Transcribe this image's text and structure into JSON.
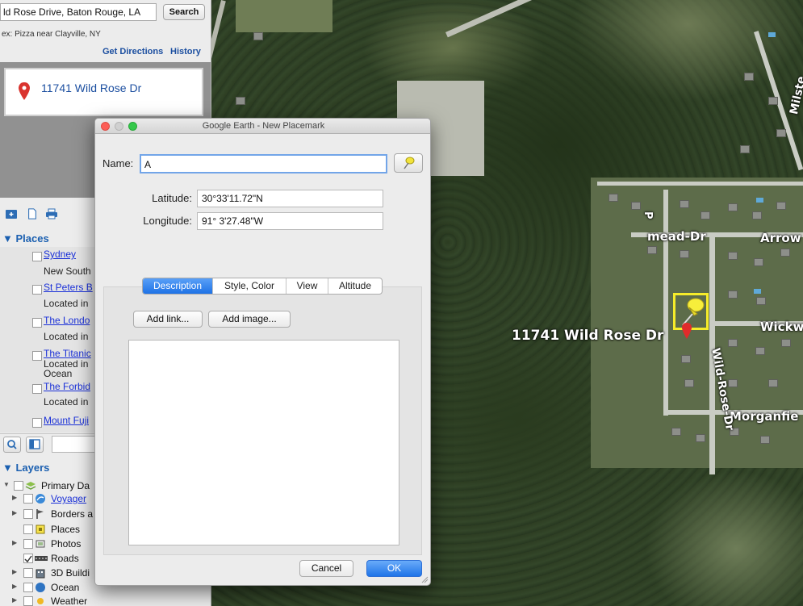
{
  "search": {
    "value": "ld Rose Drive, Baton Rouge, LA",
    "button_label": "Search",
    "hint": "ex: Pizza near Clayville, NY",
    "get_directions": "Get Directions",
    "history": "History"
  },
  "result": {
    "title": "11741 Wild Rose Dr"
  },
  "places": {
    "header": "▼ Places",
    "items": [
      {
        "title": "Sydney",
        "desc": "New South"
      },
      {
        "title": "St Peters B",
        "desc": "Located in"
      },
      {
        "title": "The Londo",
        "desc": "Located in"
      },
      {
        "title": "The Titanic",
        "desc": "Located in",
        "desc2": "Ocean"
      },
      {
        "title": "The Forbid",
        "desc": "Located in"
      },
      {
        "title": "Mount Fuji"
      }
    ]
  },
  "layers": {
    "header": "▼ Layers",
    "items": [
      {
        "label": "Primary Da",
        "link": false,
        "icon": "layers-icon"
      },
      {
        "label": "Voyager",
        "link": true,
        "icon": "voyager-icon"
      },
      {
        "label": "Borders a",
        "link": false,
        "icon": "flag-icon"
      },
      {
        "label": "Places",
        "link": false,
        "icon": "places-icon"
      },
      {
        "label": "Photos",
        "link": false,
        "icon": "photos-icon"
      },
      {
        "label": "Roads",
        "link": false,
        "icon": "roads-icon"
      },
      {
        "label": "3D Buildi",
        "link": false,
        "icon": "buildings-icon"
      },
      {
        "label": "Ocean",
        "link": false,
        "icon": "ocean-icon"
      },
      {
        "label": "Weather",
        "link": false,
        "icon": "weather-icon"
      }
    ]
  },
  "dialog": {
    "title": "Google Earth - New Placemark",
    "name_label": "Name:",
    "name_value": "A",
    "latitude_label": "Latitude:",
    "latitude_value": "30°33'11.72\"N",
    "longitude_label": "Longitude:",
    "longitude_value": "91° 3'27.48\"W",
    "tabs": [
      "Description",
      "Style, Color",
      "View",
      "Altitude"
    ],
    "add_link": "Add link...",
    "add_image": "Add image...",
    "cancel": "Cancel",
    "ok": "OK"
  },
  "map": {
    "placemark_label": "11741 Wild Rose Dr",
    "streets": {
      "mead": "mead-Dr",
      "arrow": "Arrow",
      "wickw": "Wickw",
      "morganfie": "Morganfie",
      "wild_rose": "Wild-Rose-Dr",
      "milste": "Milste",
      "partial": "P"
    }
  },
  "colors": {
    "accent": "#1e72e6",
    "link": "#1a30d8",
    "pin_highlight": "#f6ec2a"
  }
}
